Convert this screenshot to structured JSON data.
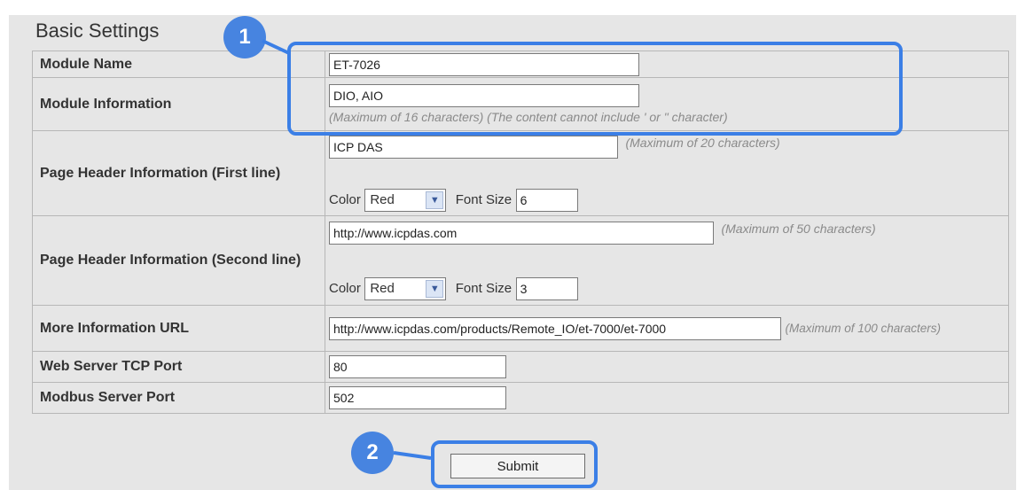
{
  "section_title": "Basic Settings",
  "rows": {
    "module_name": {
      "label": "Module Name",
      "value": "ET-7026"
    },
    "module_info": {
      "label": "Module Information",
      "value": "DIO, AIO",
      "hint": "(Maximum of 16 characters) (The content cannot include ' or \" character)"
    },
    "header1": {
      "label": "Page Header Information (First line)",
      "value": "ICP DAS",
      "hint": "(Maximum of 20 characters)",
      "color_label": "Color",
      "color_value": "Red",
      "font_size_label": "Font Size",
      "font_size_value": "6"
    },
    "header2": {
      "label": "Page Header Information (Second line)",
      "value": "http://www.icpdas.com",
      "hint": "(Maximum of 50 characters)",
      "color_label": "Color",
      "color_value": "Red",
      "font_size_label": "Font Size",
      "font_size_value": "3"
    },
    "more_info_url": {
      "label": "More Information URL",
      "value": "http://www.icpdas.com/products/Remote_IO/et-7000/et-7000",
      "hint": "(Maximum of 100 characters)"
    },
    "web_port": {
      "label": "Web Server TCP Port",
      "value": "80"
    },
    "modbus_port": {
      "label": "Modbus Server Port",
      "value": "502"
    }
  },
  "submit_label": "Submit",
  "callouts": {
    "one": "1",
    "two": "2",
    "color": "#3b7fe6"
  },
  "icons": {
    "dropdown": "chevron-down-icon"
  }
}
